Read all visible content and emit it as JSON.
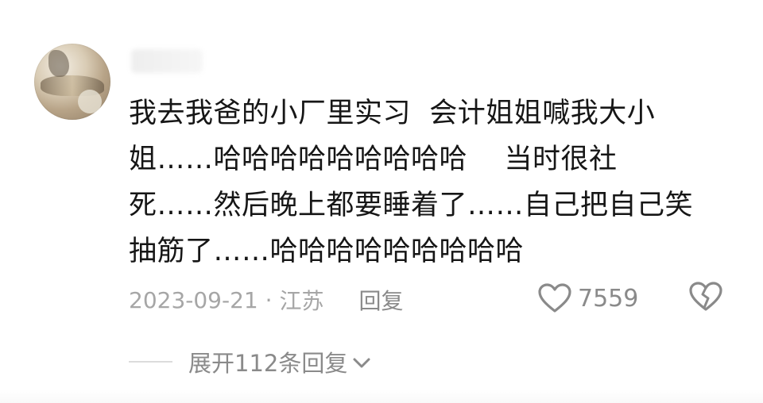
{
  "comment": {
    "text_lines": [
      "我去我爸的小厂里实习  会计姐姐喊我大小",
      "姐……哈哈哈哈哈哈哈哈哈    当时很社",
      "死……然后晚上都要睡着了……自己把自己笑",
      "抽筋了……哈哈哈哈哈哈哈哈哈"
    ],
    "date": "2023-09-21",
    "separator": " · ",
    "location": "江苏",
    "reply_label": "回复",
    "like_count": "7559",
    "icons": {
      "like": "heart-outline-icon",
      "dislike": "broken-heart-icon",
      "expand": "chevron-down-icon"
    }
  },
  "replies": {
    "expand_label": "展开112条回复"
  },
  "colors": {
    "text": "#161616",
    "meta": "#a6a6a6",
    "secondary": "#8a8a8a",
    "divider": "#dcdcdc"
  }
}
